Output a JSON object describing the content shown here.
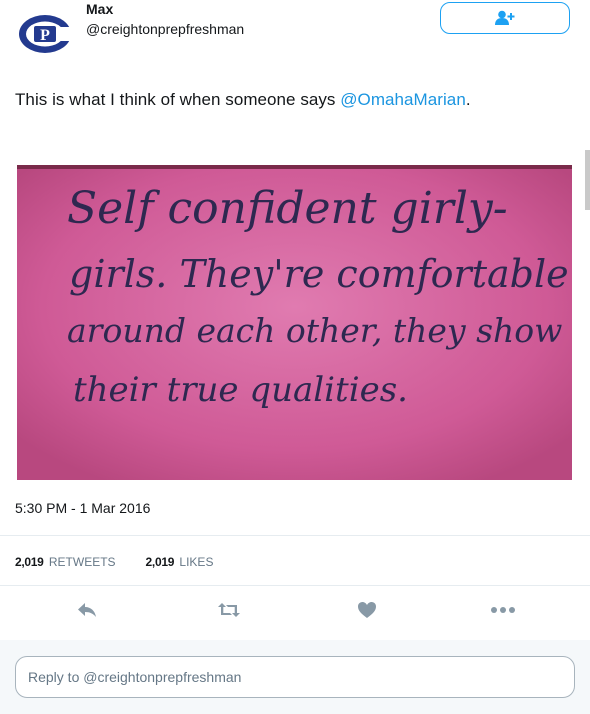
{
  "user": {
    "display_name": "Max",
    "handle": "@creightonprepfreshman",
    "avatar_icon": "creighton-prep-logo"
  },
  "follow_button": {
    "icon": "follow-user-icon",
    "color": "#1da1f2"
  },
  "tweet": {
    "text_prefix": "This is what I think of when someone says ",
    "mention": "@OmahaMarian",
    "text_suffix": ".",
    "image": {
      "background_color": "#c4427f",
      "lines": [
        "Self confident girly-",
        "girls. They're comfortable",
        "around each other, they show",
        "their true qualities."
      ]
    },
    "timestamp": "5:30 PM - 1 Mar 2016"
  },
  "stats": {
    "retweets_count": "2,019",
    "retweets_label": "RETWEETS",
    "likes_count": "2,019",
    "likes_label": "LIKES"
  },
  "actions": {
    "reply_icon": "reply-icon",
    "retweet_icon": "retweet-icon",
    "like_icon": "heart-icon",
    "more_icon": "more-icon"
  },
  "reply_box": {
    "placeholder": "Reply to @creightonprepfreshman"
  }
}
